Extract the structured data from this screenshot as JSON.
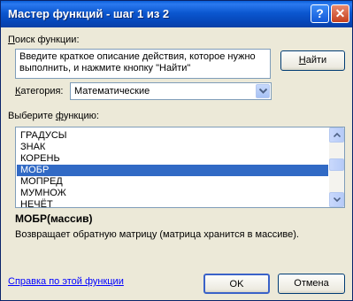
{
  "window": {
    "title": "Мастер функций - шаг 1 из 2",
    "help_label": "?",
    "close_label": "✕"
  },
  "search": {
    "label_accel": "П",
    "label_rest": "оиск функции:",
    "text": "Введите краткое описание действия, которое нужно\nвыполнить, и нажмите кнопку \"Найти\"",
    "find_accel": "Н",
    "find_rest": "айти"
  },
  "category": {
    "label_accel": "К",
    "label_rest": "атегория:",
    "value": "Математические"
  },
  "functions": {
    "label_pre": "Выберите ",
    "label_accel": "ф",
    "label_rest": "ункцию:",
    "items": [
      "ГРАДУСЫ",
      "ЗНАК",
      "КОРЕНЬ",
      "МОБР",
      "МОПРЕД",
      "МУМНОЖ",
      "НЕЧЁТ"
    ],
    "selected_index": 3
  },
  "selected_function": {
    "signature": "МОБР(массив)",
    "description": "Возвращает обратную матрицу (матрица хранится в массиве)."
  },
  "help_link": "Справка по этой функции",
  "buttons": {
    "ok": "OK",
    "cancel": "Отмена"
  }
}
